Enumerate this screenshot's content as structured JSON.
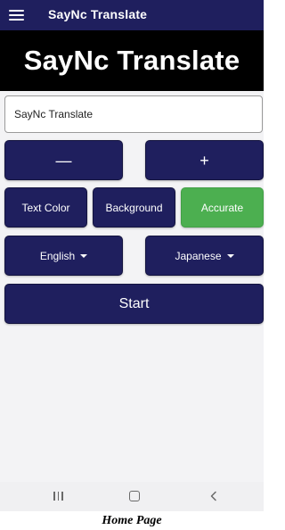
{
  "app_bar": {
    "title": "SayNc Translate",
    "menu_icon": "hamburger-menu-icon"
  },
  "preview": {
    "text": "SayNc Translate",
    "text_color": "#ffffff",
    "background_color": "#000000"
  },
  "input": {
    "value": "SayNc Translate"
  },
  "controls": {
    "decrease_label": "—",
    "increase_label": "+",
    "text_color_label": "Text Color",
    "background_label": "Background",
    "accurate_label": "Accurate",
    "source_language": "English",
    "target_language": "Japanese",
    "start_label": "Start"
  },
  "nav_bar": {
    "recents_icon": "recents-icon",
    "home_icon": "home-icon",
    "back_icon": "back-icon"
  },
  "caption": "Home Page",
  "colors": {
    "primary": "#1f1f5e",
    "accent_green": "#4caf50",
    "surface": "#f3f3f5"
  }
}
